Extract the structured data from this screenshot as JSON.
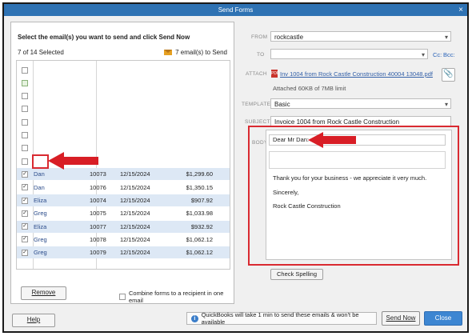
{
  "window": {
    "title": "Send Forms",
    "close_glyph": "×"
  },
  "left_panel": {
    "heading_prefix": "Select the email(s) you want to send and click ",
    "heading_action": "Send Now",
    "selected_count": "7 of 14 Selected",
    "to_send": "7 email(s) to Send",
    "rows": [
      {
        "checked": false,
        "name": "",
        "num": "",
        "date": "",
        "amount": ""
      },
      {
        "checked": false,
        "green": true,
        "name": "",
        "num": "",
        "date": "",
        "amount": ""
      },
      {
        "checked": false,
        "name": "",
        "num": "",
        "date": "",
        "amount": ""
      },
      {
        "checked": false,
        "name": "",
        "num": "",
        "date": "",
        "amount": ""
      },
      {
        "checked": false,
        "name": "",
        "num": "",
        "date": "",
        "amount": ""
      },
      {
        "checked": false,
        "name": "",
        "num": "",
        "date": "",
        "amount": ""
      },
      {
        "checked": false,
        "name": "",
        "num": "",
        "date": "",
        "amount": ""
      },
      {
        "checked": false,
        "name": "",
        "num": "",
        "date": "",
        "amount": ""
      },
      {
        "checked": true,
        "name": "Dan",
        "num": "10073",
        "date": "12/15/2024",
        "amount": "$1,299.60"
      },
      {
        "checked": true,
        "name": "Dan",
        "num": "10076",
        "date": "12/15/2024",
        "amount": "$1,350.15"
      },
      {
        "checked": true,
        "name": "Eliza",
        "num": "10074",
        "date": "12/15/2024",
        "amount": "$907.92"
      },
      {
        "checked": true,
        "name": "Greg",
        "num": "10075",
        "date": "12/15/2024",
        "amount": "$1,033.98"
      },
      {
        "checked": true,
        "name": "Eliza",
        "num": "10077",
        "date": "12/15/2024",
        "amount": "$932.92"
      },
      {
        "checked": true,
        "name": "Greg",
        "num": "10078",
        "date": "12/15/2024",
        "amount": "$1,062.12"
      },
      {
        "checked": true,
        "name": "Greg",
        "num": "10079",
        "date": "12/15/2024",
        "amount": "$1,062.12"
      }
    ],
    "remove_label": "Remove",
    "combine_label": "Combine forms to a recipient in one email"
  },
  "form": {
    "from_label": "FROM",
    "from_value": "rockcastle",
    "to_label": "TO",
    "to_value": "",
    "cc_label": "Cc:",
    "bcc_label": "Bcc:",
    "attach_label": "ATTACH",
    "attach_file": "Inv 1004 from Rock Castle Construction 40004 13048.pdf",
    "attach_note": "Attached 60KB of 7MB limit",
    "template_label": "TEMPLATE",
    "template_value": "Basic",
    "subject_label": "SUBJECT",
    "subject_value": "Invoice 1004 from Rock Castle Construction",
    "body_label": "BODY",
    "body_dear": "Dear Mr Dan:",
    "body_line1": "Thank you for your business - we appreciate it very much.",
    "body_line2": "Sincerely,",
    "body_line3": "Rock Castle Construction",
    "check_spelling": "Check Spelling"
  },
  "footer": {
    "help_label": "Help",
    "info_text": "QuickBooks will take 1 min to send these emails & won't be available",
    "send_now_label": "Send Now",
    "close_label": "Close"
  },
  "colors": {
    "accent": "#2e72b3",
    "highlight": "#d92a31",
    "arrow": "#d81e26"
  }
}
